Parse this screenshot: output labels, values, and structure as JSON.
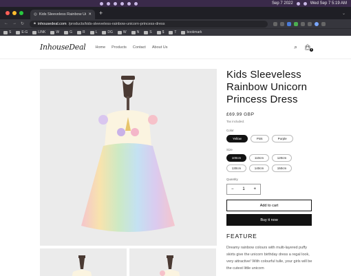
{
  "menubar": {
    "date": "Sep 7 2022",
    "clock": "Wed Sep 7  5:19 AM"
  },
  "browser": {
    "tab_title": "Kids Sleeveless Rainbow Unic",
    "url_host": "inhousedeal.com",
    "url_path": "/products/kids-sleeveless-rainbow-unicorn-princess-dress",
    "bookmarks": [
      "S",
      "E-G",
      "LINK",
      "W",
      "G",
      "R",
      "L",
      "DG",
      "W",
      "N",
      "S",
      "$",
      "T",
      "bookmark"
    ]
  },
  "store": {
    "logo": "InhouseDeal",
    "nav": [
      "Home",
      "Products",
      "Contact",
      "About Us"
    ],
    "cart_count": "1"
  },
  "product": {
    "title": "Kids Sleeveless Rainbow Unicorn Princess Dress",
    "price": "£69.99 GBP",
    "tax_note": "Tax included.",
    "color_label": "Color",
    "colors": [
      "Yellow",
      "Pink",
      "Purple"
    ],
    "size_label": "Size",
    "sizes": [
      "100cm",
      "110cm",
      "120cm",
      "130cm",
      "140cm",
      "150cm"
    ],
    "quantity_label": "Quantity",
    "quantity": "1",
    "qty_minus": "−",
    "qty_plus": "+",
    "add_to_cart": "Add to cart",
    "buy_now": "Buy it now",
    "feature_heading": "FEATURE",
    "description": "Dreamy rainbow colours with multi-layered puffy skirts give the unicorn birthday dress a regal look, very attractive! With colourful tulle, your girls will be the cutest little unicorn"
  }
}
